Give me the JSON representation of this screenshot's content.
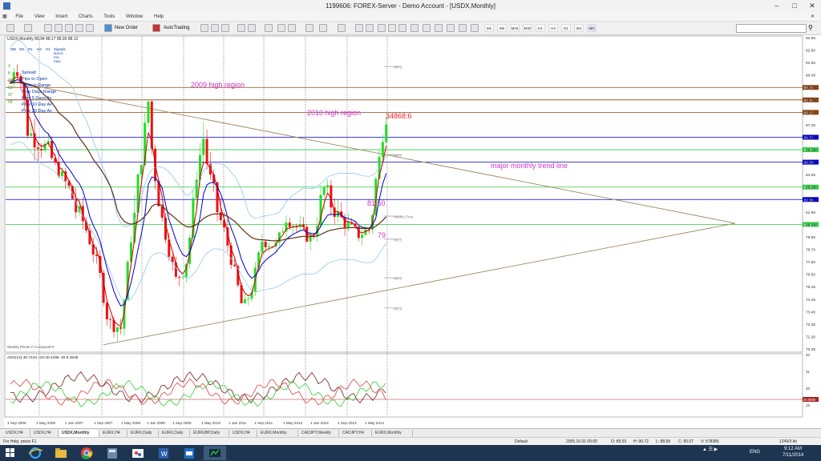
{
  "window": {
    "title": "1199606: FOREX-Server - Demo Account - [USDX,Monthly]"
  },
  "menu": [
    "File",
    "View",
    "Insert",
    "Charts",
    "Tools",
    "Window",
    "Help"
  ],
  "toolbar": {
    "new_order": "New Order",
    "autotrading": "AutoTrading",
    "timeframes": [
      "M1",
      "M5",
      "M15",
      "M30",
      "H1",
      "H4",
      "D1",
      "W1",
      "MN"
    ]
  },
  "chart": {
    "symbol_header": "USDX,Monthly  86.94 88.17 86.90 88.12",
    "mini_tf": [
      "MN",
      "W1",
      "D1",
      "H4",
      "H1"
    ],
    "signals_label": "Signals",
    "signal_items": [
      "MACD",
      "RSI",
      "EMA"
    ],
    "info_lines": [
      "Spread",
      "Pips to Open",
      "Today's Range",
      "Prev Days Range",
      "Prev 5 Days Av",
      "Prev 10 Day Av",
      "Prev 20 Day Av"
    ],
    "left_nums": [
      "3",
      "8",
      "12",
      "53",
      "97",
      "58"
    ],
    "annotations": {
      "high_2009": "2009 high region",
      "high_2010": "2010 high region",
      "counter": "34868:6",
      "trend": "major monthly trend line",
      "level_8150": "81.50",
      "level_79": "79"
    },
    "pivot_labels": [
      "WR 2",
      "WR 1",
      "Weekly Pivot",
      "WS 1",
      "WS 2",
      "WS 3"
    ],
    "footer_note": "Weekly Pivots © CompassFX",
    "price_axis": [
      "92.95",
      "92.60",
      "91.55",
      "90.45",
      "89.00",
      "88.55",
      "88.12",
      "87.25",
      "86.77",
      "86.00",
      "85.26",
      "84.05",
      "83.00",
      "82.36",
      "81.95",
      "80.90",
      "79.80",
      "78.70",
      "77.60",
      "76.50",
      "75.45",
      "74.45",
      "73.40",
      "72.35",
      "71.30",
      "70.25"
    ],
    "price_tags": [
      {
        "label": "89.00",
        "color": "#8b4513"
      },
      {
        "label": "88.55",
        "color": "#8b4513"
      },
      {
        "label": "88.12",
        "color": "#8b4513"
      },
      {
        "label": "86.77",
        "color": "#0000cc"
      },
      {
        "label": "86.00",
        "color": "#2ecc40"
      },
      {
        "label": "85.26",
        "color": "#0000cc"
      },
      {
        "label": "83.00",
        "color": "#2ecc40"
      },
      {
        "label": "82.36",
        "color": "#0000cc"
      },
      {
        "label": "80.90",
        "color": "#2ecc40"
      }
    ],
    "adx_header": "ADX(14) 30.7434 +DI:40.4498 -DI:8.3548",
    "adx_axis": [
      "40",
      "31",
      "20",
      "16"
    ],
    "adx_tag": "20.0000",
    "date_axis": [
      "1 Sep 2005",
      "1 May 2006",
      "1 Jan 2007",
      "1 Sep 2007",
      "1 May 2008",
      "1 Jan 2009",
      "1 Sep 2009",
      "1 May 2010",
      "1 Jan 2011",
      "1 Sep 2011",
      "1 May 2012",
      "1 Jan 2013",
      "1 Sep 2013",
      "1 May 2014"
    ],
    "colors": {
      "bull": "#22dd22",
      "bear": "#ee1111",
      "trend": "#a08860",
      "annotation": "#cc33cc",
      "ema_fast": "#cc0000",
      "ema_mid": "#0000cc",
      "ema_slow": "#603010",
      "bb": "#90c8f0"
    }
  },
  "tabs": [
    "USDX,H4",
    "USDX,H4",
    "USDX,Monthly",
    "EURX,H4",
    "EURX,Daily",
    "EURX,Daily",
    "EURGBP,Daily",
    "USDX,H4",
    "EURX,Monthly",
    "CADJPY,Weekly",
    "CADJPY,H4",
    "EURX,Monthly"
  ],
  "status": {
    "help": "For Help, press F1",
    "profile": "Default",
    "datetime": "2005.10.01 00:00",
    "open": "O: 89.53",
    "high": "H: 90.72",
    "low": "L: 88.58",
    "close": "C: 90.07",
    "volume": "V: 578385",
    "traffic": "1249/3 kb"
  },
  "taskbar": {
    "lang": "ENG",
    "time": "9:12 AM",
    "date": "7/11/2014"
  }
}
